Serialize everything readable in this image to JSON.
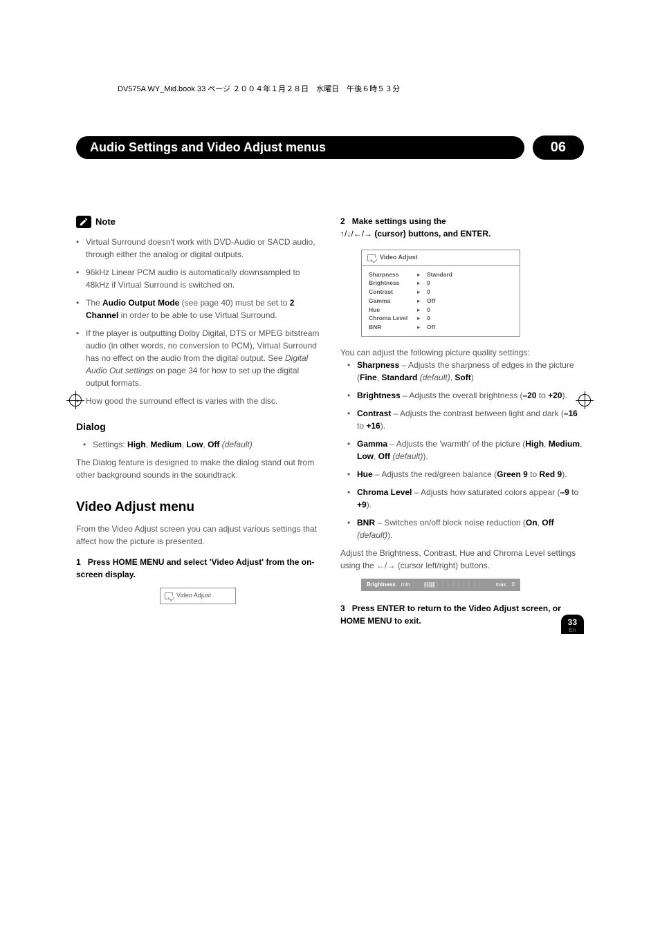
{
  "header_line": "DV575A WY_Mid.book 33 ページ ２００４年１月２８日　水曜日　午後６時５３分",
  "title_bar": "Audio Settings and Video Adjust menus",
  "chapter": "06",
  "note_label": "Note",
  "notes": {
    "n1": "Virtual Surround doesn't work with DVD-Audio or SACD audio, through either the ",
    "n1b": "analog or digital outputs.",
    "n2": "96kHz Linear PCM audio is automatically downsampled to 48kHz if Virtual Surround is switched on.",
    "n3a": "The ",
    "n3b": "Audio Output Mode",
    "n3c": " (see page 40) must be set to ",
    "n3d": "2 Channel",
    "n3e": " in ",
    "n3f": "order to be able to use Virtual Surround.",
    "n4a": "If the player is outputting Dolby Digital, DTS or MPEG bitstream audio (in other words, no conversion to PCM), Virtual Surround has no effect on the audio from the digital output. See ",
    "n4b": "Digital Audio Out settings",
    "n4c": " on page 34 for how to set up the digital output formats.",
    "n5": "How good the surround effect is varies with the disc."
  },
  "dialog": {
    "title": "Dialog",
    "settings_label": "Settings: ",
    "high": "High",
    "medium": "Medium",
    "low": "Low",
    "off": "Off",
    "default": "(default)",
    "body": "The Dialog feature is designed to make the dialog stand out from other background sounds in the soundtrack."
  },
  "vam": {
    "heading": "Video Adjust menu",
    "intro": "From the Video Adjust screen you can adjust various settings that affect how the picture is presented.",
    "step1a": "1",
    "step1b": "Press HOME MENU and select 'Video Adjust' from the on-screen display.",
    "menu_label": "Video Adjust"
  },
  "col2": {
    "step2a": "2",
    "step2b": "Make settings using the ",
    "step2c": " (cursor) buttons, and ENTER.",
    "va_title": "Video Adjust",
    "rows": {
      "sharpness": {
        "label": "Sharpness",
        "val": "Standard"
      },
      "brightness": {
        "label": "Brightness",
        "val": "0"
      },
      "contrast": {
        "label": "Contrast",
        "val": "0"
      },
      "gamma": {
        "label": "Gamma",
        "val": "Off"
      },
      "hue": {
        "label": "Hue",
        "val": "0"
      },
      "chroma": {
        "label": "Chroma Level",
        "val": "0"
      },
      "bnr": {
        "label": "BNR",
        "val": "Off"
      }
    },
    "intro2": "You can adjust the following picture quality settings:",
    "items": {
      "sharp_a": "Sharpness",
      "sharp_b": " – Adjusts the sharpness of edges in the picture (",
      "sharp_c": "Fine",
      "sharp_d": "Standard",
      "sharp_e": "(default)",
      "sharp_f": "Soft",
      "bright_a": "Brightness",
      "bright_b": " – Adjusts the overall brightness (",
      "bright_c": "–20",
      "bright_d": " to ",
      "bright_e": "+20",
      "contrast_a": "Contrast",
      "contrast_b": " – Adjusts the contrast between light and dark (",
      "contrast_c": "–16",
      "contrast_d": " to ",
      "contrast_e": "+16",
      "gamma_a": "Gamma",
      "gamma_b": " – Adjusts the 'warmth' of the picture (",
      "gamma_c": "High",
      "gamma_d": "Medium",
      "gamma_e": "Low",
      "gamma_f": "Off",
      "gamma_g": "(default)",
      "hue_a": "Hue",
      "hue_b": " – Adjusts the red/green balance (",
      "hue_c": "Green 9",
      "hue_d": " to ",
      "hue_e": "Red 9",
      "chroma_a": "Chroma Level",
      "chroma_b": " – Adjusts how saturated colors appear (",
      "chroma_c": "–9",
      "chroma_d": " to ",
      "chroma_e": "+9",
      "bnr_a": "BNR",
      "bnr_b": " – Switches on/off block noise reduction (",
      "bnr_c": "On",
      "bnr_d": "Off",
      "bnr_e": "(default)"
    },
    "adjust_text_a": "Adjust the Brightness, Contrast, Hue and Chroma Level settings using the ",
    "adjust_text_b": " (cursor left/right) buttons.",
    "slider": {
      "label": "Brightness",
      "min": "min",
      "max": "max",
      "val": "0"
    },
    "step3a": "3",
    "step3b": "Press ENTER to return to the Video Adjust screen, or HOME MENU to exit."
  },
  "page_num": "33",
  "page_lang": "En"
}
